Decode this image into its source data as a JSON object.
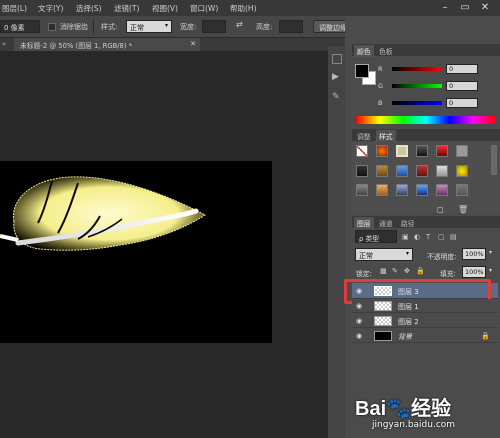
{
  "menubar": {
    "items": [
      "图层(L)",
      "文字(Y)",
      "选择(S)",
      "滤镜(T)",
      "视图(V)",
      "窗口(W)",
      "帮助(H)"
    ],
    "window_controls": [
      "–",
      "▭",
      "✕"
    ]
  },
  "options": {
    "feather_value": "0 像素",
    "antialias_label": "消除锯齿",
    "style_label": "样式:",
    "style_value": "正常",
    "width_label": "宽度:",
    "height_label": "高度:",
    "refine_edge_label": "调整边缘..."
  },
  "document": {
    "tab_label": "未标题-2 @ 50% (图层 1, RGB/8) *",
    "tab_close": "✕"
  },
  "color_panel": {
    "tabs": [
      "颜色",
      "色板"
    ],
    "channels": [
      {
        "label": "R",
        "value": "0",
        "color": "#ff0000"
      },
      {
        "label": "G",
        "value": "0",
        "color": "#00ff00"
      },
      {
        "label": "B",
        "value": "0",
        "color": "#0000ff"
      }
    ]
  },
  "styles_panel": {
    "tabs": [
      "调整",
      "样式"
    ]
  },
  "layers_panel": {
    "tabs": [
      "图层",
      "通道",
      "路径"
    ],
    "filter_kind": "ρ 类型",
    "blend_mode": "正常",
    "opacity_label": "不透明度:",
    "opacity_value": "100%",
    "lock_label": "锁定:",
    "fill_label": "填充:",
    "fill_value": "100%",
    "layers": [
      {
        "name": "图层 3",
        "selected": true
      },
      {
        "name": "图层 1",
        "selected": false
      },
      {
        "name": "图层 2",
        "selected": false
      },
      {
        "name": "背景",
        "selected": false,
        "locked": true
      }
    ]
  },
  "watermark": {
    "brand_text": "Bai",
    "brand_suffix": "经验",
    "url": "jingyan.baidu.com"
  },
  "colors": {
    "highlight_border": "#e03c3c",
    "selected_layer_bg": "#5b6c88",
    "feather_yellow": "#f4ee8a"
  }
}
